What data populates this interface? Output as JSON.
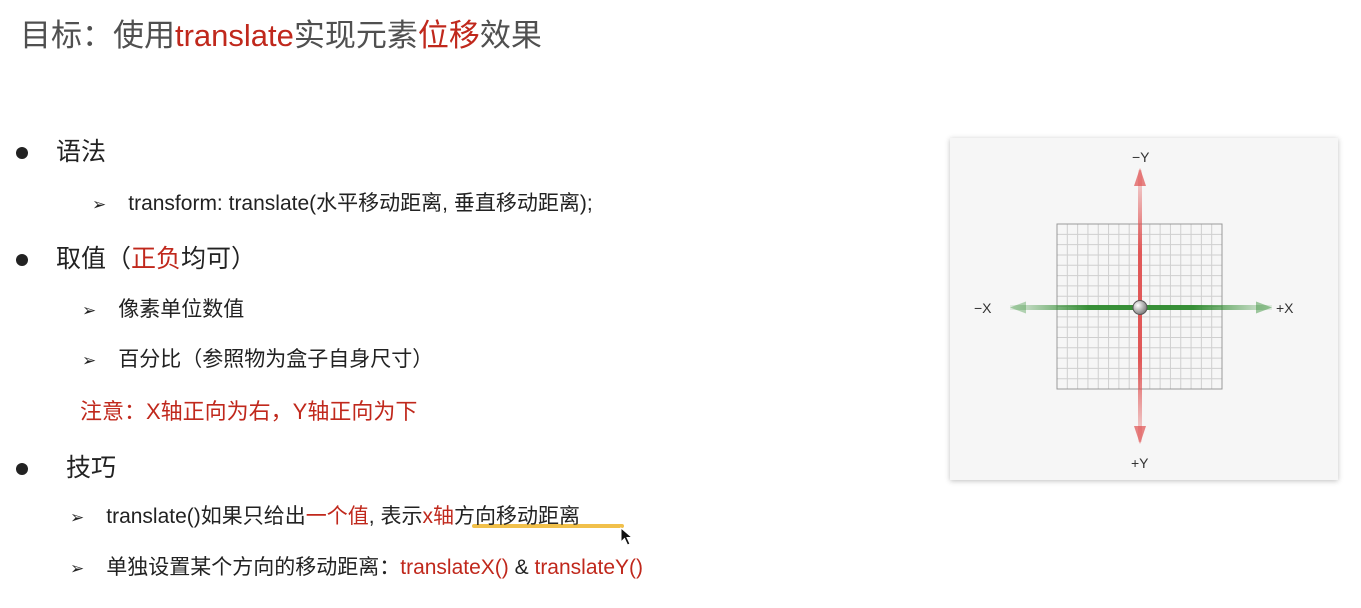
{
  "title": {
    "pre": "目标：使用",
    "t1": "translate",
    "mid": "实现元素",
    "t2": "位移",
    "post": "效果"
  },
  "syntax": {
    "heading": "语法",
    "code_pre": "transform: translate(",
    "code_args": "水平移动距离, 垂直移动距离",
    "code_post": ");"
  },
  "values": {
    "heading_pre": "取值（",
    "heading_red": "正负",
    "heading_post": "均可）",
    "item1": "像素单位数值",
    "item2": "百分比（参照物为盒子自身尺寸）",
    "note": "注意：X轴正向为右，Y轴正向为下"
  },
  "tips": {
    "heading": "技巧",
    "t1_a": "translate()如果只给出",
    "t1_red1": "一个值",
    "t1_b": ", 表示",
    "t1_red2": "x轴",
    "t1_c": "方向移动距离",
    "t2_a": "单独设置某个方向的移动距离：",
    "t2_red1": "translateX()",
    "t2_b": " & ",
    "t2_red2": "translateY()"
  },
  "figure": {
    "neg_y": "−Y",
    "pos_y": "+Y",
    "neg_x": "−X",
    "pos_x": "+X"
  },
  "colors": {
    "accent_red": "#c0281c",
    "axis_red": "#e05050",
    "axis_green": "#2e8b2e",
    "highlight": "#f1c04b"
  }
}
